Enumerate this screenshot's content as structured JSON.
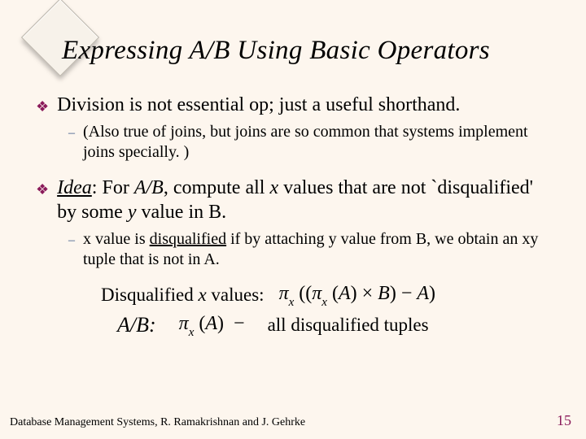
{
  "title": "Expressing A/B Using Basic Operators",
  "bullets": {
    "b1": "Division is not essential op; just a useful shorthand.",
    "b1a": "(Also true of joins, but joins are so common that systems implement joins specially. )",
    "b2_idea": "Idea",
    "b2_colon": ":  For ",
    "b2_ab": "A/B",
    "b2_mid1": ", compute all ",
    "b2_x": "x",
    "b2_mid2": " values that are not `disqualified' by some ",
    "b2_y": "y",
    "b2_tail": " value in B.",
    "b2a_x": "x",
    "b2a_1": " value is ",
    "b2a_dq": "disqualified",
    "b2a_2": " if by attaching ",
    "b2a_y": "y",
    "b2a_3": " value from ",
    "b2a_B": "B",
    "b2a_4": ", we obtain an ",
    "b2a_xy": "xy",
    "b2a_5": " tuple that is not in ",
    "b2a_A": "A",
    "b2a_6": "."
  },
  "disq": {
    "label": "Disqualified x values:",
    "formula": "π_x ((π_x (A) × B) − A)"
  },
  "ab": {
    "label": "A/B:",
    "lhs": "π_x (A) −",
    "rhs": "all disqualified tuples"
  },
  "footer": {
    "left": "Database Management Systems, R. Ramakrishnan and J. Gehrke",
    "page": "15"
  }
}
